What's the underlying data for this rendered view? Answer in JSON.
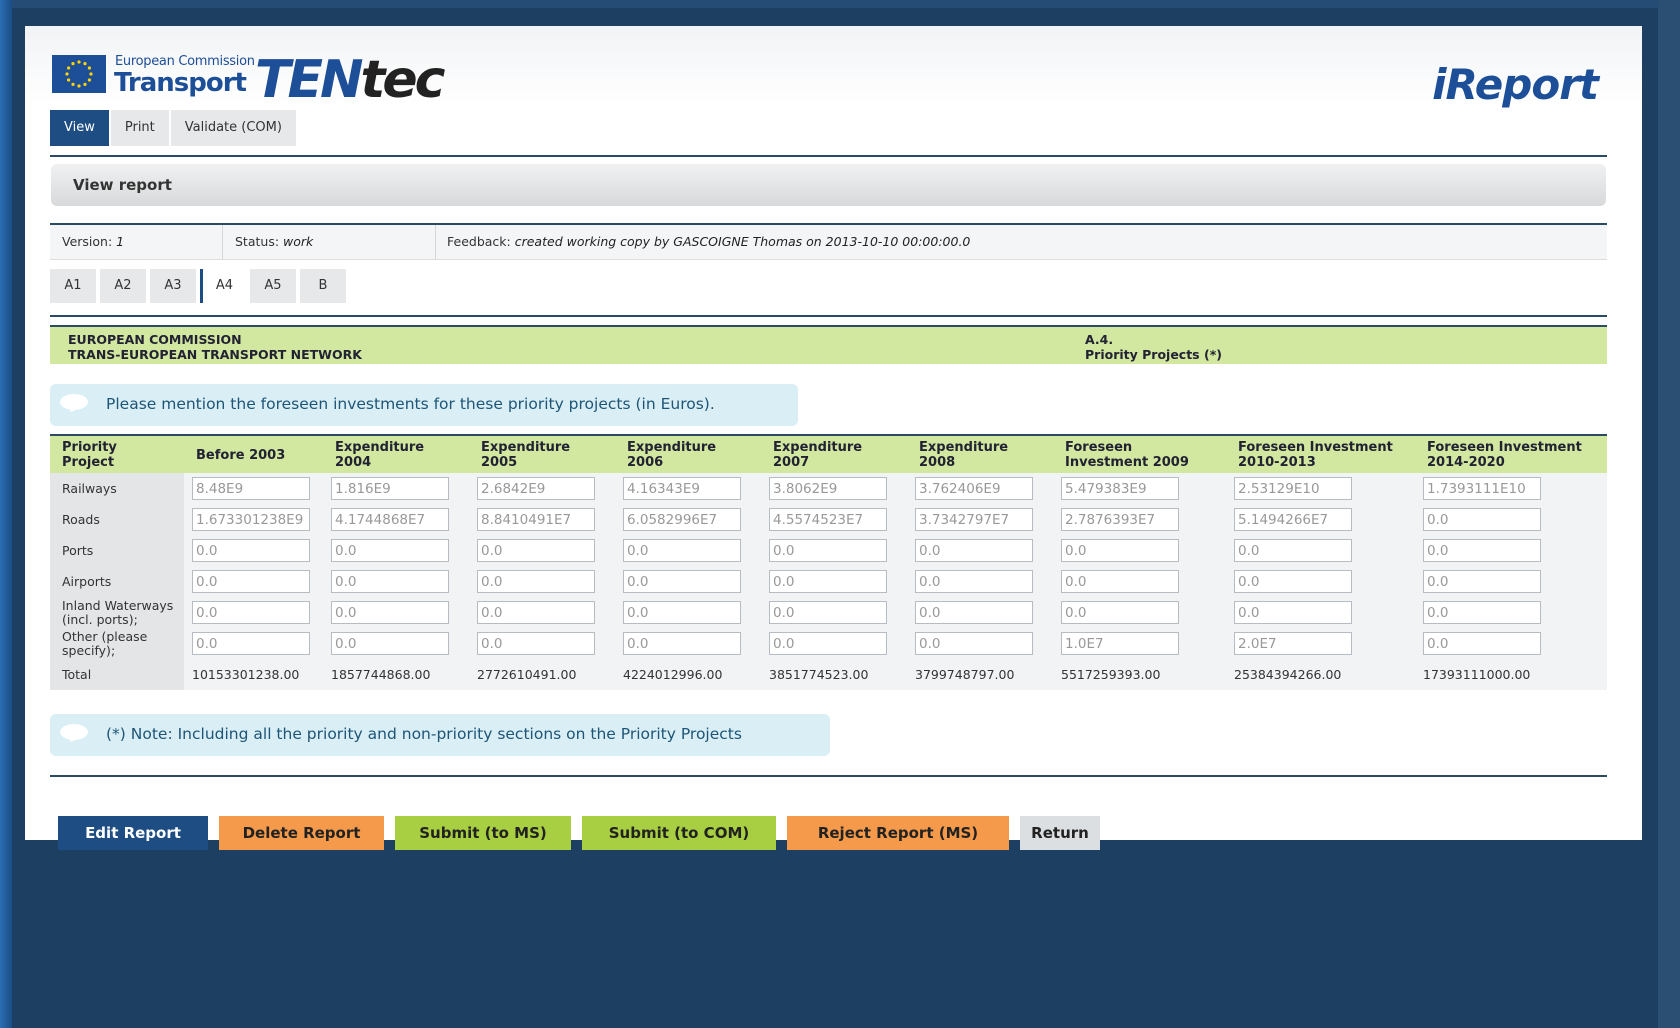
{
  "header": {
    "ec_small": "European Commission",
    "ec_transport": "Transport",
    "ten": "TEN",
    "tec": "tec",
    "ireport": "iReport"
  },
  "tabs": [
    "View",
    "Print",
    "Validate (COM)"
  ],
  "view_title": "View report",
  "info": {
    "version_label": "Version:",
    "version_value": "1",
    "status_label": "Status:",
    "status_value": "work",
    "feedback_label": "Feedback:",
    "feedback_value": "created working copy by GASCOIGNE Thomas on 2013-10-10 00:00:00.0"
  },
  "section_tabs": [
    "A1",
    "A2",
    "A3",
    "A4",
    "A5",
    "B"
  ],
  "active_section": "A4",
  "band": {
    "left_line1": "EUROPEAN COMMISSION",
    "left_line2": "TRANS-EUROPEAN TRANSPORT NETWORK",
    "right_line1": "A.4.",
    "right_line2": "Priority Projects (*)"
  },
  "instruction": "Please mention the foreseen investments for these priority projects (in Euros).",
  "table": {
    "headers": [
      [
        "Priority",
        "Project"
      ],
      [
        "Before 2003",
        ""
      ],
      [
        "Expenditure",
        "2004"
      ],
      [
        "Expenditure",
        "2005"
      ],
      [
        "Expenditure",
        "2006"
      ],
      [
        "Expenditure",
        "2007"
      ],
      [
        "Expenditure",
        "2008"
      ],
      [
        "Foreseen",
        "Investment 2009"
      ],
      [
        "Foreseen Investment",
        "2010-2013"
      ],
      [
        "Foreseen Investment",
        "2014-2020"
      ]
    ],
    "rows": [
      {
        "label": "Railways",
        "values": [
          "8.48E9",
          "1.816E9",
          "2.6842E9",
          "4.16343E9",
          "3.8062E9",
          "3.762406E9",
          "5.479383E9",
          "2.53129E10",
          "1.7393111E10"
        ]
      },
      {
        "label": "Roads",
        "values": [
          "1.673301238E9",
          "4.1744868E7",
          "8.8410491E7",
          "6.0582996E7",
          "4.5574523E7",
          "3.7342797E7",
          "2.7876393E7",
          "5.1494266E7",
          "0.0"
        ]
      },
      {
        "label": "Ports",
        "values": [
          "0.0",
          "0.0",
          "0.0",
          "0.0",
          "0.0",
          "0.0",
          "0.0",
          "0.0",
          "0.0"
        ]
      },
      {
        "label": "Airports",
        "values": [
          "0.0",
          "0.0",
          "0.0",
          "0.0",
          "0.0",
          "0.0",
          "0.0",
          "0.0",
          "0.0"
        ]
      },
      {
        "label": "Inland Waterways (incl. ports);",
        "values": [
          "0.0",
          "0.0",
          "0.0",
          "0.0",
          "0.0",
          "0.0",
          "0.0",
          "0.0",
          "0.0"
        ]
      },
      {
        "label": "Other (please specify);",
        "values": [
          "0.0",
          "0.0",
          "0.0",
          "0.0",
          "0.0",
          "0.0",
          "1.0E7",
          "2.0E7",
          "0.0"
        ]
      }
    ],
    "total_label": "Total",
    "totals": [
      "10153301238.00",
      "1857744868.00",
      "2772610491.00",
      "4224012996.00",
      "3851774523.00",
      "3799748797.00",
      "5517259393.00",
      "25384394266.00",
      "17393111000.00"
    ]
  },
  "footnote": "(*) Note: Including all the priority and non-priority sections on the Priority Projects",
  "buttons": [
    {
      "label": "Edit Report",
      "style": "blue"
    },
    {
      "label": "Delete Report",
      "style": "orange"
    },
    {
      "label": "Submit (to MS)",
      "style": "green"
    },
    {
      "label": "Submit (to COM)",
      "style": "green"
    },
    {
      "label": "Reject Report (MS)",
      "style": "orange"
    },
    {
      "label": "Return",
      "style": "grey"
    }
  ],
  "colors": {
    "brand_blue": "#1e4d83",
    "band_green": "#d2e7a0",
    "button_orange": "#f49a4a",
    "button_green": "#a7cf41",
    "background_navy": "#1c3f62"
  }
}
